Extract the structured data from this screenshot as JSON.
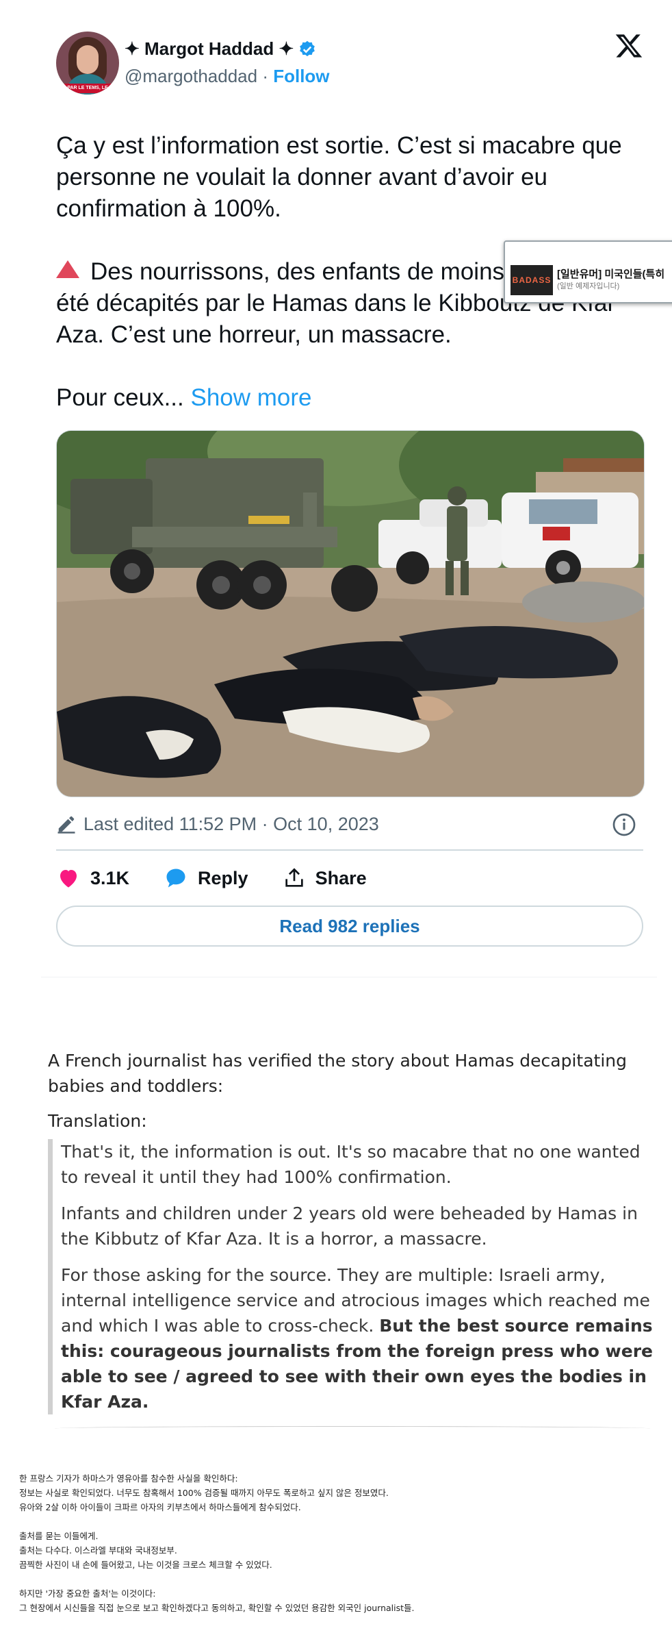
{
  "tweet": {
    "display_name": "✦ Margot Haddad ✦",
    "handle": "@margothaddad",
    "dot": "·",
    "follow_label": "Follow",
    "avatar_banner": "PAR LE TEMS, LE",
    "paragraphs": [
      "Ça y est l’information est sortie. C’est si macabre que personne ne voulait la donner avant d’avoir eu confirmation à 100%.",
      "Des nourrissons, des enfants de moins de 2 ans ont été décapités par le Hamas dans le Kibboutz de Kfar Aza. C’est une horreur, un massacre."
    ],
    "truncated_text": "Pour ceux...",
    "show_more_label": "Show more",
    "edited_text": "Last edited 11:52 PM · Oct 10, 2023",
    "likes_count": "3.1K",
    "reply_label": "Reply",
    "share_label": "Share",
    "read_replies_label": "Read 982 replies",
    "colors": {
      "accent": "#1d9bf0",
      "like": "#f91880",
      "warning": "#e0475b",
      "text": "#0f1419",
      "muted": "#536471"
    }
  },
  "ad": {
    "thumb_text": "BADASS",
    "title": "[일반유머] 미국인들(특히",
    "subtitle": "(일반 예제자입니다)"
  },
  "article": {
    "intro": "A French journalist has verified the story about Hamas decapitating babies and toddlers:",
    "translation_label": "Translation:",
    "quote_p1": "That's it, the information is out. It's so macabre that no one wanted to reveal it until they had 100% confirmation.",
    "quote_p2": "Infants and children under 2 years old were beheaded by Hamas in the Kibbutz of Kfar Aza. It is a horror, a massacre.",
    "quote_p3_plain": "For those asking for the source. They are multiple: Israeli army, internal intelligence service and atrocious images which reached me and which I was able to cross-check. ",
    "quote_p3_bold": "But the best source remains this: courageous journalists from the foreign press who were able to see / agreed to see with their own eyes the bodies in Kfar Aza."
  },
  "korean": {
    "lines": [
      "한 프랑스 기자가 하마스가 영유아를 참수한 사실을 확인하다:",
      "정보는 사실로 확인되었다. 너무도 참혹해서 100% 검증될 때까지 아무도 폭로하고 싶지 않은 정보였다.",
      "유아와 2살 이하 아이들이 크파르 아자의 키부츠에서 하마스들에게 참수되었다.",
      "",
      "출처를 묻는 이들에게.",
      "출처는 다수다. 이스라엘 부대와 국내정보부.",
      "끔찍한 사진이 내 손에 들어왔고, 나는 이것을 크로스 체크할 수 있었다.",
      "",
      "하지만 '가장 중요한 출처'는 이것이다:",
      "그 현장에서 시신들을 직접 눈으로 보고 확인하겠다고 동의하고,  확인할 수 있었던 용감한 외국인 journalist들."
    ]
  }
}
